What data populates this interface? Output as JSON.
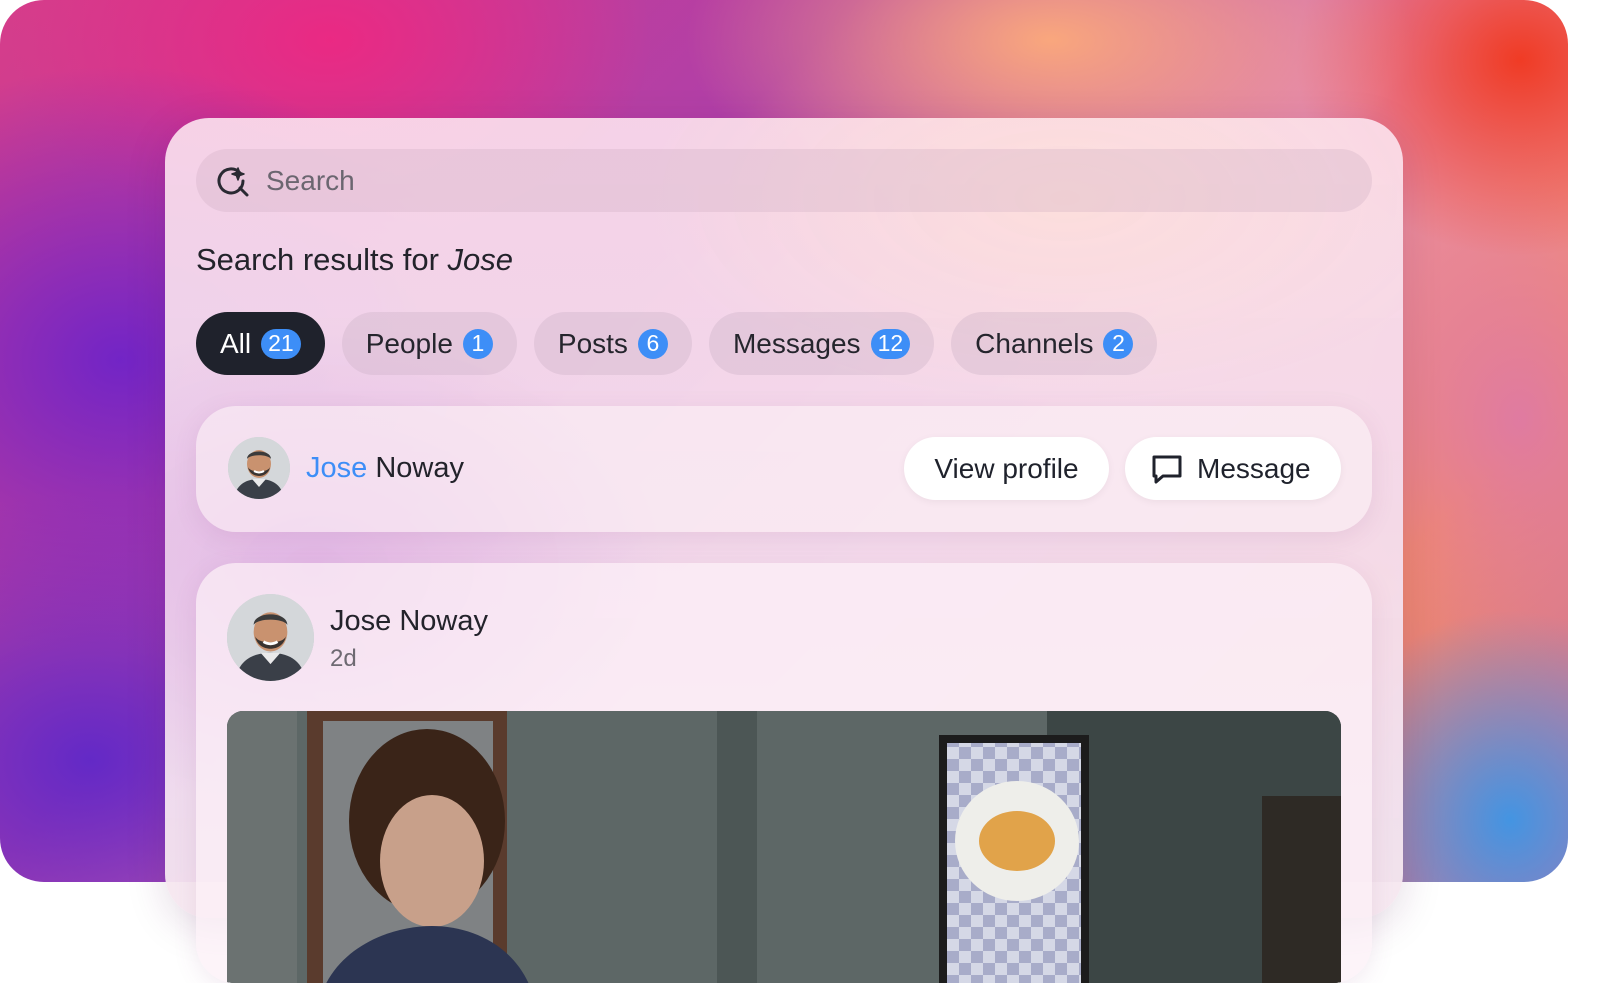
{
  "search": {
    "placeholder": "Search"
  },
  "heading": {
    "prefix": "Search results for ",
    "query": "Jose"
  },
  "tabs": [
    {
      "label": "All",
      "count": "21",
      "active": true
    },
    {
      "label": "People",
      "count": "1",
      "active": false
    },
    {
      "label": "Posts",
      "count": "6",
      "active": false
    },
    {
      "label": "Messages",
      "count": "12",
      "active": false
    },
    {
      "label": "Channels",
      "count": "2",
      "active": false
    }
  ],
  "person_result": {
    "name_match": "Jose",
    "name_rest": " Noway",
    "view_profile_label": "View profile",
    "message_label": "Message"
  },
  "post_result": {
    "author": "Jose Noway",
    "time": "2d"
  },
  "colors": {
    "accent": "#3d8ef7",
    "active_tab": "#1f222c"
  }
}
